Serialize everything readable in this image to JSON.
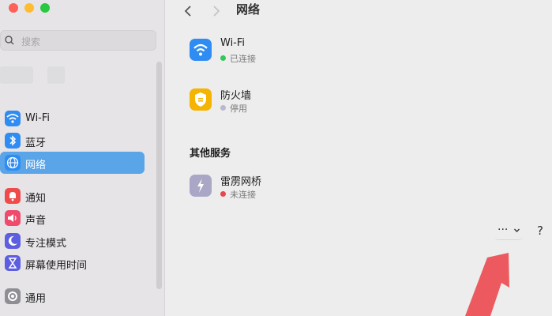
{
  "window": {
    "title": "网络"
  },
  "sidebar": {
    "search_placeholder": "搜索",
    "items": [
      {
        "label": "Wi-Fi",
        "icon": "wifi-icon",
        "color": "#2f8cf2"
      },
      {
        "label": "蓝牙",
        "icon": "bluetooth-icon",
        "color": "#2f8cf2"
      },
      {
        "label": "网络",
        "icon": "globe-icon",
        "color": "#2f8cf2",
        "selected": true
      },
      {
        "label": "通知",
        "icon": "bell-icon",
        "color": "#ef4b4b"
      },
      {
        "label": "声音",
        "icon": "speaker-icon",
        "color": "#ef4b6c"
      },
      {
        "label": "专注模式",
        "icon": "moon-icon",
        "color": "#5d5fe0"
      },
      {
        "label": "屏幕使用时间",
        "icon": "hourglass-icon",
        "color": "#5d5fe0"
      },
      {
        "label": "通用",
        "icon": "gear-icon",
        "color": "#8e8e93"
      }
    ]
  },
  "main": {
    "services": [
      {
        "name": "Wi-Fi",
        "status": "已连接",
        "status_color": "#34c759",
        "icon": "wifi-icon",
        "icon_color": "#2f8cf2"
      },
      {
        "name": "防火墙",
        "status": "停用",
        "status_color": "#b8b8d0",
        "icon": "firewall-shield-icon",
        "icon_color": "#f4b400"
      }
    ],
    "other_section_title": "其他服务",
    "other_services": [
      {
        "name": "雷雳网桥",
        "status": "未连接",
        "status_color": "#e5484d",
        "icon": "thunderbolt-icon",
        "icon_color": "#a9a6c6"
      }
    ],
    "more_label": "···",
    "help_label": "?"
  },
  "accent_color": "#5aa4e8"
}
